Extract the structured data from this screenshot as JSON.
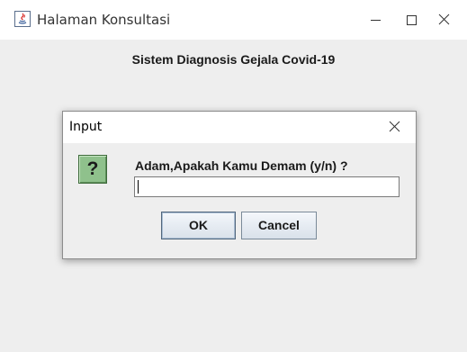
{
  "window": {
    "title": "Halaman Konsultasi",
    "icons": [
      "java-app-icon",
      "minimize-icon",
      "maximize-icon",
      "close-icon"
    ]
  },
  "main": {
    "heading": "Sistem Diagnosis Gejala Covid-19"
  },
  "dialog": {
    "title": "Input",
    "icon": "question-icon",
    "icon_glyph": "?",
    "prompt": "Adam,Apakah Kamu Demam (y/n) ?",
    "input_value": "",
    "ok_label": "OK",
    "cancel_label": "Cancel"
  },
  "colors": {
    "background": "#eeeeee",
    "titlebar": "#ffffff",
    "question_icon": "#8fc18c"
  }
}
